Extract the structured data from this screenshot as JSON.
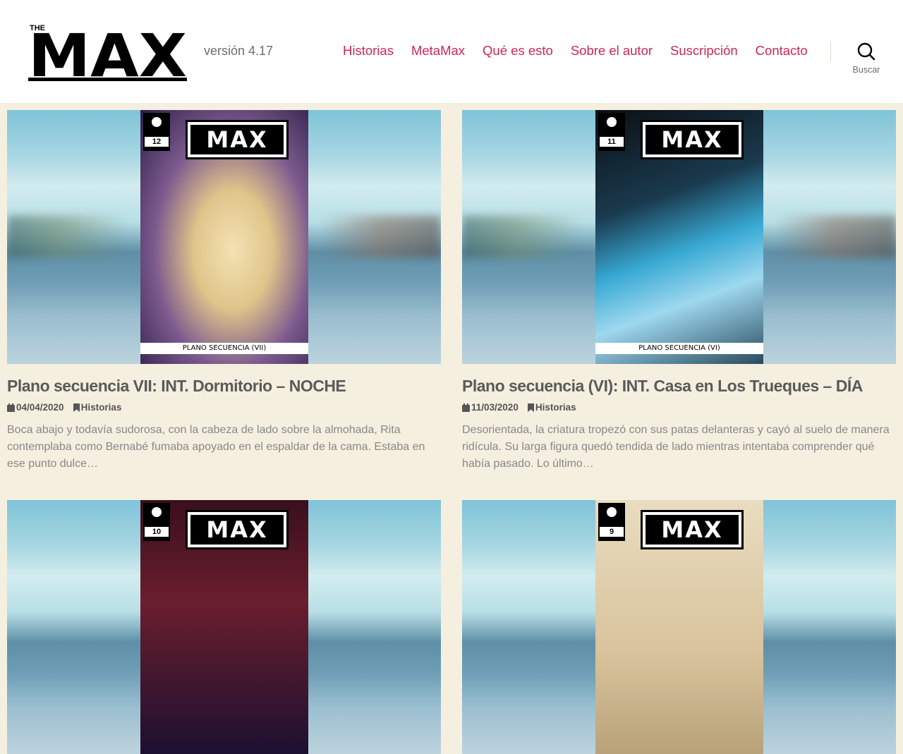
{
  "header": {
    "logo_text": "THE MAX",
    "tagline": "versión 4.17",
    "nav": [
      "Historias",
      "MetaMax",
      "Qué es esto",
      "Sobre el autor",
      "Suscripción",
      "Contacto"
    ],
    "search_label": "Buscar"
  },
  "colors": {
    "accent": "#cd2653",
    "page_bg": "#f5efe0",
    "muted": "#6d6d6d"
  },
  "posts": [
    {
      "cover_number": "12",
      "cover_caption": "PLANO SECUENCIA (VII)",
      "title": "Plano secuencia VII: INT. Dormitorio – NOCHE",
      "date": "04/04/2020",
      "category": "Historias",
      "excerpt": "Boca abajo y todavía sudorosa, con la cabeza de lado sobre la almohada, Rita contemplaba como Bernabé fumaba apoyado en el espaldar de la cama. Estaba en ese punto dulce…"
    },
    {
      "cover_number": "11",
      "cover_caption": "PLANO SECUENCIA (VI)",
      "title": "Plano secuencia (VI): INT. Casa en Los Trueques – DÍA",
      "date": "11/03/2020",
      "category": "Historias",
      "excerpt": "Desorientada, la criatura tropezó con sus patas delanteras y cayó al suelo de manera ridícula. Su larga figura quedó tendida de lado mientras intentaba comprender qué había pasado. Lo último…"
    },
    {
      "cover_number": "10",
      "cover_caption": "",
      "title": "",
      "date": "",
      "category": "",
      "excerpt": ""
    },
    {
      "cover_number": "9",
      "cover_caption": "",
      "title": "",
      "date": "",
      "category": "",
      "excerpt": ""
    }
  ],
  "cover_logo_text": "MAX"
}
